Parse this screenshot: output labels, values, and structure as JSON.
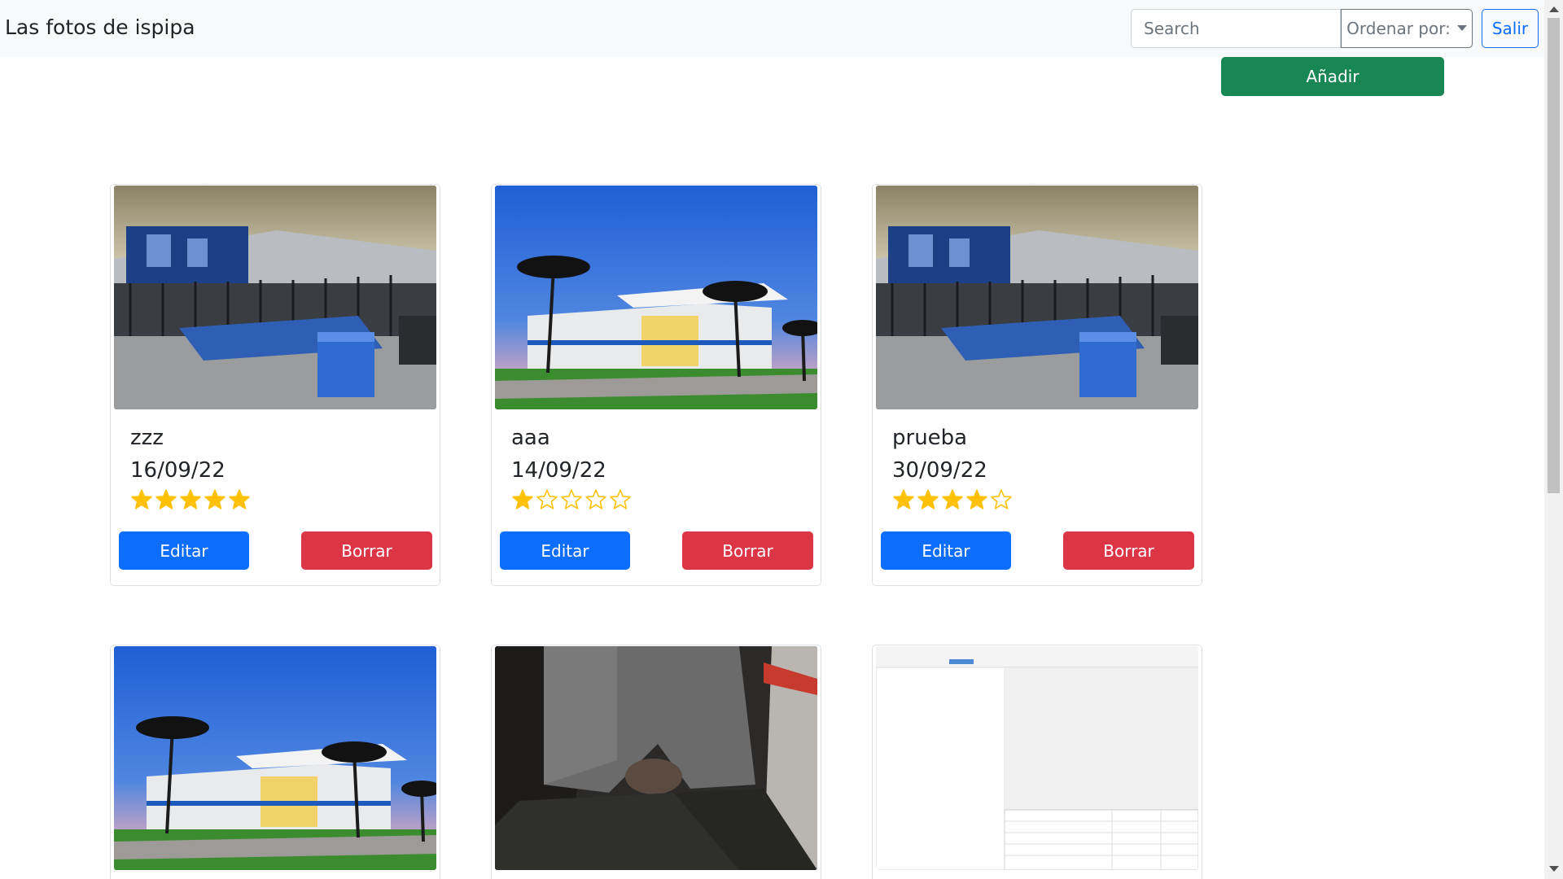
{
  "navbar": {
    "brand": "Las fotos de ispipa",
    "search_placeholder": "Search",
    "sort_label": "Ordenar por:",
    "exit_label": "Salir"
  },
  "add_label": "Añadir",
  "colors": {
    "star": "#ffc107",
    "edit": "#0d6efd",
    "delete": "#dc3545",
    "add": "#198754"
  },
  "photos": [
    {
      "title": "zzz",
      "date": "16/09/22",
      "rating": 5,
      "image": "gym-interior",
      "edit_label": "Editar",
      "delete_label": "Borrar"
    },
    {
      "title": "aaa",
      "date": "14/09/22",
      "rating": 1,
      "image": "building-palms",
      "edit_label": "Editar",
      "delete_label": "Borrar"
    },
    {
      "title": "prueba",
      "date": "30/09/22",
      "rating": 4,
      "image": "gym-interior",
      "edit_label": "Editar",
      "delete_label": "Borrar"
    },
    {
      "image": "building-palms"
    },
    {
      "image": "person-jacket"
    },
    {
      "image": "app-screenshot"
    }
  ]
}
